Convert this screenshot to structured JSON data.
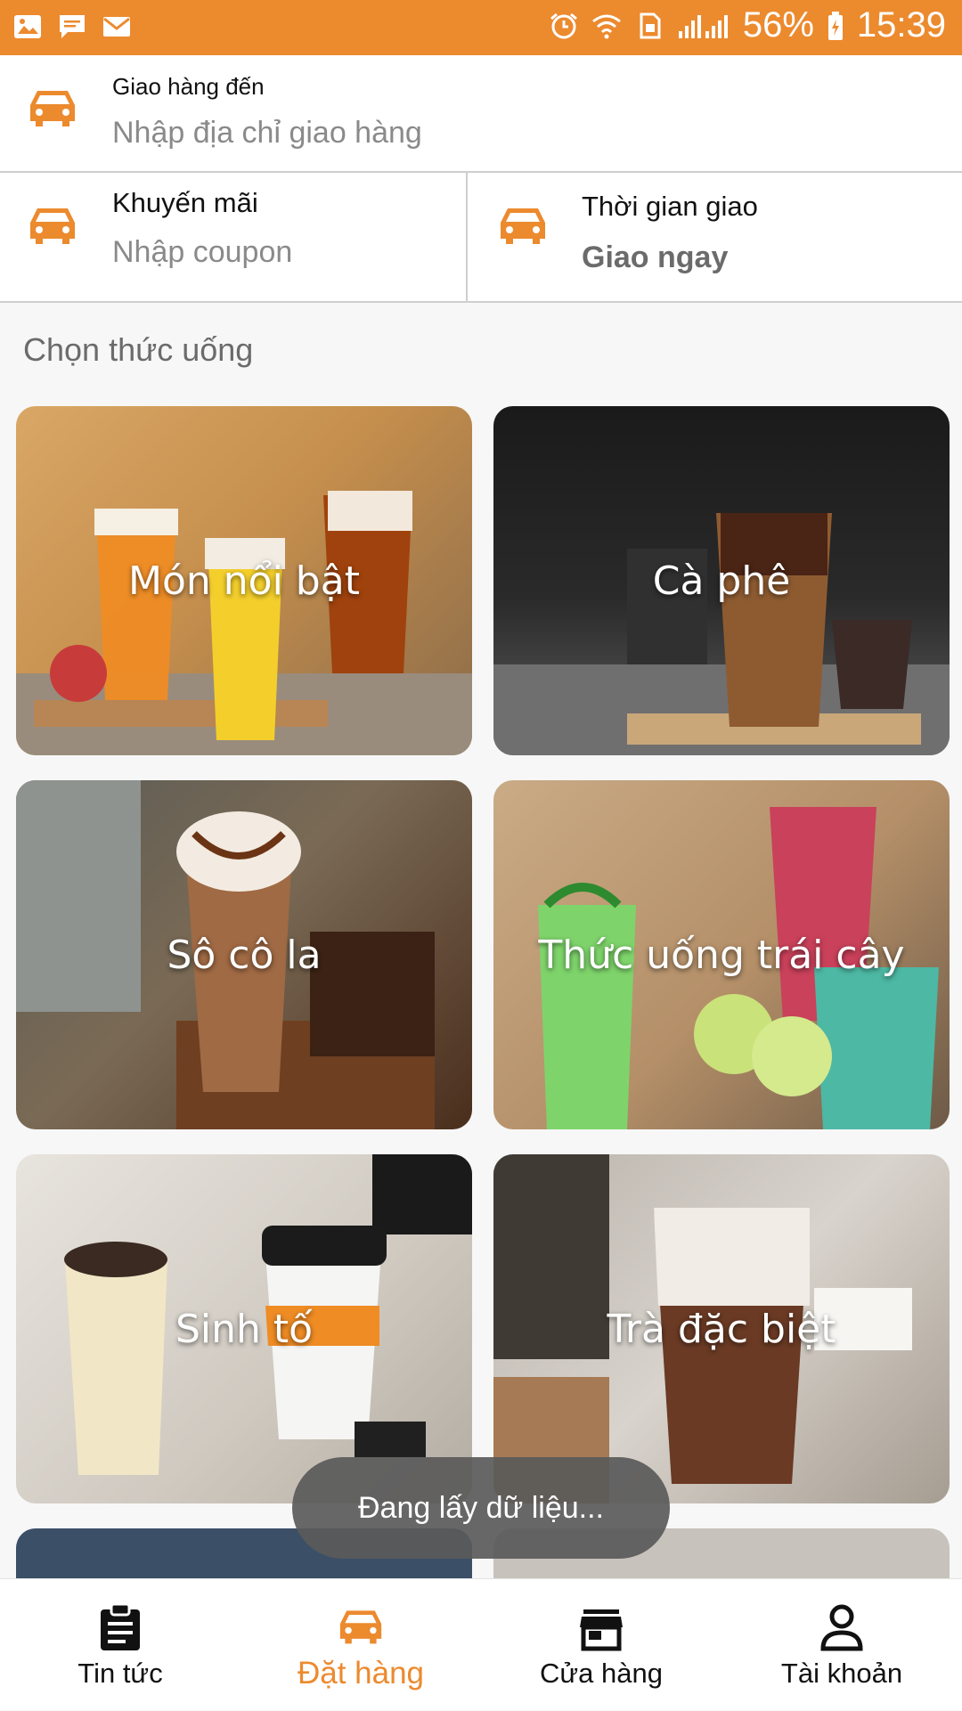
{
  "status_bar": {
    "battery": "56%",
    "time": "15:39",
    "icons": [
      "image-icon",
      "message-icon",
      "mail-icon",
      "alarm-icon",
      "wifi-icon",
      "sim-icon",
      "signal-icon",
      "battery-icon"
    ]
  },
  "delivery": {
    "label": "Giao hàng đến",
    "placeholder": "Nhập địa chỉ giao hàng"
  },
  "promo": {
    "label": "Khuyến mãi",
    "placeholder": "Nhập coupon"
  },
  "time": {
    "label": "Thời gian giao",
    "value": "Giao ngay"
  },
  "section_title": "Chọn thức uống",
  "categories": [
    {
      "label": "Món nổi bật"
    },
    {
      "label": "Cà phê"
    },
    {
      "label": "Sô cô la"
    },
    {
      "label": "Thức uống trái cây"
    },
    {
      "label": "Sinh tố"
    },
    {
      "label": "Trà đặc biệt"
    }
  ],
  "toast": "Đang lấy dữ liệu...",
  "nav": [
    {
      "label": "Tin tức",
      "icon": "clipboard-icon"
    },
    {
      "label": "Đặt hàng",
      "icon": "car-icon"
    },
    {
      "label": "Cửa hàng",
      "icon": "store-icon"
    },
    {
      "label": "Tài khoản",
      "icon": "person-icon"
    }
  ],
  "colors": {
    "accent": "#ec8a2e"
  }
}
